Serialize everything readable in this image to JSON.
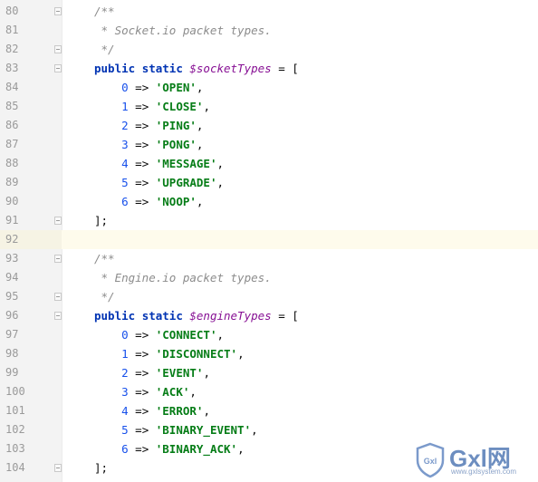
{
  "lines": [
    {
      "n": "80",
      "fold": "open",
      "tokens": [
        [
          "c",
          "/**"
        ]
      ]
    },
    {
      "n": "81",
      "tokens": [
        [
          "c",
          " * Socket.io packet types."
        ]
      ]
    },
    {
      "n": "82",
      "fold": "close",
      "tokens": [
        [
          "c",
          " */"
        ]
      ]
    },
    {
      "n": "83",
      "fold": "open",
      "tokens": [
        [
          "k",
          "public"
        ],
        [
          "o",
          " "
        ],
        [
          "k",
          "static"
        ],
        [
          "o",
          " "
        ],
        [
          "v",
          "$socketTypes"
        ],
        [
          "o",
          " = ["
        ]
      ]
    },
    {
      "n": "84",
      "tokens": [
        [
          "o",
          "    "
        ],
        [
          "n",
          "0"
        ],
        [
          "o",
          " => "
        ],
        [
          "s",
          "'OPEN'"
        ],
        [
          "o",
          ","
        ]
      ]
    },
    {
      "n": "85",
      "tokens": [
        [
          "o",
          "    "
        ],
        [
          "n",
          "1"
        ],
        [
          "o",
          " => "
        ],
        [
          "s",
          "'CLOSE'"
        ],
        [
          "o",
          ","
        ]
      ]
    },
    {
      "n": "86",
      "tokens": [
        [
          "o",
          "    "
        ],
        [
          "n",
          "2"
        ],
        [
          "o",
          " => "
        ],
        [
          "s",
          "'PING'"
        ],
        [
          "o",
          ","
        ]
      ]
    },
    {
      "n": "87",
      "tokens": [
        [
          "o",
          "    "
        ],
        [
          "n",
          "3"
        ],
        [
          "o",
          " => "
        ],
        [
          "s",
          "'PONG'"
        ],
        [
          "o",
          ","
        ]
      ]
    },
    {
      "n": "88",
      "tokens": [
        [
          "o",
          "    "
        ],
        [
          "n",
          "4"
        ],
        [
          "o",
          " => "
        ],
        [
          "s",
          "'MESSAGE'"
        ],
        [
          "o",
          ","
        ]
      ]
    },
    {
      "n": "89",
      "tokens": [
        [
          "o",
          "    "
        ],
        [
          "n",
          "5"
        ],
        [
          "o",
          " => "
        ],
        [
          "s",
          "'UPGRADE'"
        ],
        [
          "o",
          ","
        ]
      ]
    },
    {
      "n": "90",
      "tokens": [
        [
          "o",
          "    "
        ],
        [
          "n",
          "6"
        ],
        [
          "o",
          " => "
        ],
        [
          "s",
          "'NOOP'"
        ],
        [
          "o",
          ","
        ]
      ]
    },
    {
      "n": "91",
      "fold": "close",
      "tokens": [
        [
          "o",
          "];"
        ]
      ]
    },
    {
      "n": "92",
      "current": true,
      "tokens": []
    },
    {
      "n": "93",
      "fold": "open",
      "tokens": [
        [
          "c",
          "/**"
        ]
      ]
    },
    {
      "n": "94",
      "tokens": [
        [
          "c",
          " * Engine.io packet types."
        ]
      ]
    },
    {
      "n": "95",
      "fold": "close",
      "tokens": [
        [
          "c",
          " */"
        ]
      ]
    },
    {
      "n": "96",
      "fold": "open",
      "tokens": [
        [
          "k",
          "public"
        ],
        [
          "o",
          " "
        ],
        [
          "k",
          "static"
        ],
        [
          "o",
          " "
        ],
        [
          "v",
          "$engineTypes"
        ],
        [
          "o",
          " = ["
        ]
      ]
    },
    {
      "n": "97",
      "tokens": [
        [
          "o",
          "    "
        ],
        [
          "n",
          "0"
        ],
        [
          "o",
          " => "
        ],
        [
          "s",
          "'CONNECT'"
        ],
        [
          "o",
          ","
        ]
      ]
    },
    {
      "n": "98",
      "tokens": [
        [
          "o",
          "    "
        ],
        [
          "n",
          "1"
        ],
        [
          "o",
          " => "
        ],
        [
          "s",
          "'DISCONNECT'"
        ],
        [
          "o",
          ","
        ]
      ]
    },
    {
      "n": "99",
      "tokens": [
        [
          "o",
          "    "
        ],
        [
          "n",
          "2"
        ],
        [
          "o",
          " => "
        ],
        [
          "s",
          "'EVENT'"
        ],
        [
          "o",
          ","
        ]
      ]
    },
    {
      "n": "100",
      "tokens": [
        [
          "o",
          "    "
        ],
        [
          "n",
          "3"
        ],
        [
          "o",
          " => "
        ],
        [
          "s",
          "'ACK'"
        ],
        [
          "o",
          ","
        ]
      ]
    },
    {
      "n": "101",
      "tokens": [
        [
          "o",
          "    "
        ],
        [
          "n",
          "4"
        ],
        [
          "o",
          " => "
        ],
        [
          "s",
          "'ERROR'"
        ],
        [
          "o",
          ","
        ]
      ]
    },
    {
      "n": "102",
      "tokens": [
        [
          "o",
          "    "
        ],
        [
          "n",
          "5"
        ],
        [
          "o",
          " => "
        ],
        [
          "s",
          "'BINARY_EVENT'"
        ],
        [
          "o",
          ","
        ]
      ]
    },
    {
      "n": "103",
      "tokens": [
        [
          "o",
          "    "
        ],
        [
          "n",
          "6"
        ],
        [
          "o",
          " => "
        ],
        [
          "s",
          "'BINARY_ACK'"
        ],
        [
          "o",
          ","
        ]
      ]
    },
    {
      "n": "104",
      "fold": "close",
      "tokens": [
        [
          "o",
          "];"
        ]
      ]
    }
  ],
  "watermark": {
    "logo_text": "Gxl",
    "brand": "Gxl网",
    "url": "www.gxlsystem.com"
  },
  "colors": {
    "comment": "#8c8c8c",
    "keyword": "#0033b3",
    "variable": "#871094",
    "number": "#1750eb",
    "string": "#067d17",
    "current_line": "#fefbec",
    "gutter": "#f3f3f3"
  }
}
